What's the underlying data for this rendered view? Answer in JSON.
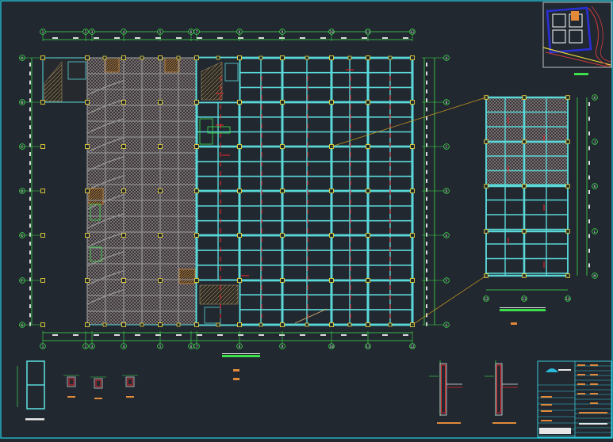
{
  "drawing": {
    "colors": {
      "background": "#212830",
      "border": "#22d3e6",
      "beam": "#5ad8d8",
      "dimension": "#3ee04a",
      "column": "#e7d23a",
      "rebar": "#e8242a",
      "slab_hatch": "#b9b9b9",
      "stair": "#c88a3a",
      "title_block": "#39c8d8",
      "site_blue": "#2a2fd6",
      "site_road_red": "#d23a3a",
      "site_road_yellow": "#e7d23a",
      "leader": "#d8a020"
    },
    "grid_bubbles_top": [
      "1",
      "2",
      "3",
      "4",
      "5",
      "6",
      "7",
      "8",
      "9",
      "10",
      "11",
      "12",
      "13",
      "14",
      "15"
    ],
    "grid_bubbles_left": [
      "A",
      "B",
      "C",
      "D",
      "E",
      "F",
      "G",
      "H"
    ],
    "grid_bubbles_right": [
      "A",
      "B",
      "C",
      "D",
      "E",
      "F",
      "G",
      "H"
    ],
    "detail_bubbles_right": [
      "H",
      "J",
      "K",
      "L",
      "M"
    ],
    "detail_bubbles_bottom": [
      "12",
      "13",
      "14"
    ],
    "site_plan": {
      "label": ""
    },
    "sections": [
      {
        "id": "section-a"
      },
      {
        "id": "section-b"
      }
    ]
  }
}
